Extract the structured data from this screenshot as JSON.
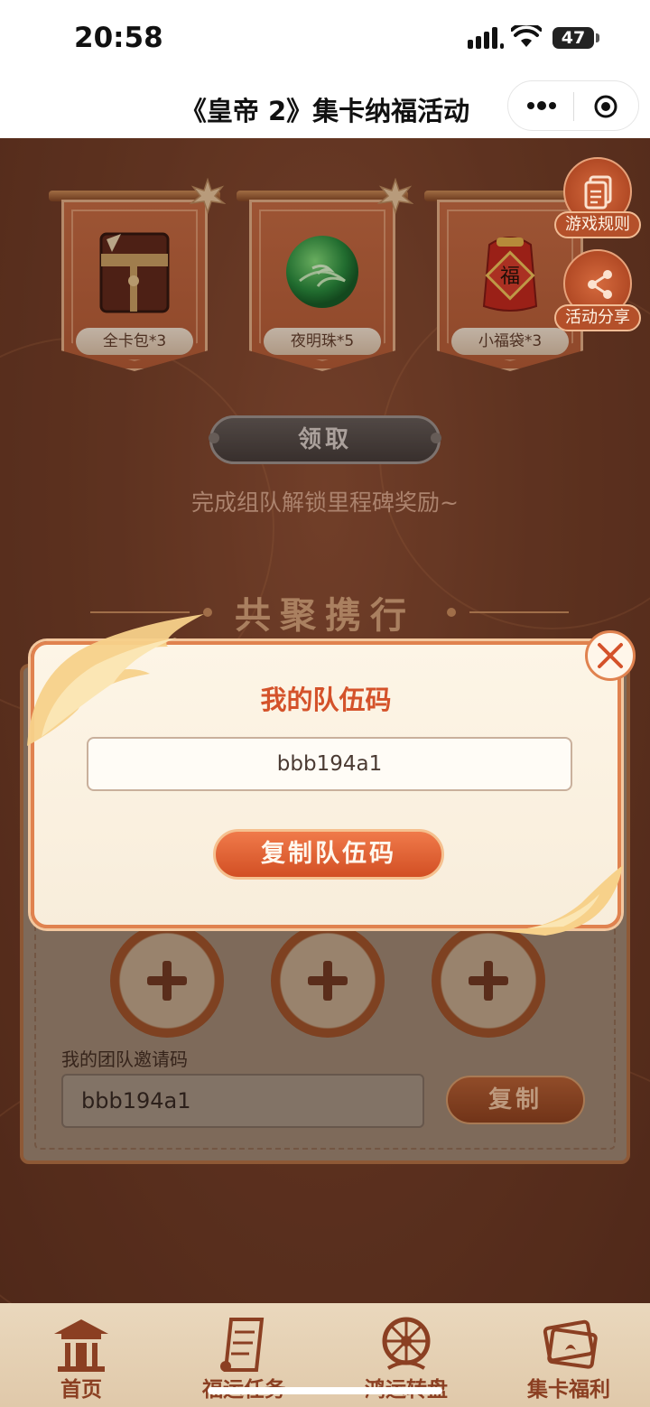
{
  "status_bar": {
    "time": "20:58",
    "battery": "47"
  },
  "nav": {
    "title": "《皇帝 2》集卡纳福活动",
    "more_icon": "more-dots-icon",
    "close_icon": "target-circle-icon"
  },
  "rewards": [
    {
      "label": "全卡包*3",
      "icon": "card-pack-icon"
    },
    {
      "label": "夜明珠*5",
      "icon": "pearl-icon"
    },
    {
      "label": "小福袋*3",
      "icon": "lucky-bag-icon"
    }
  ],
  "claim_button": "领取",
  "hint": "完成组队解锁里程碑奖励~",
  "section_title": "共聚携行",
  "side_buttons": [
    {
      "label": "游戏规则",
      "icon": "rules-document-icon"
    },
    {
      "label": "活动分享",
      "icon": "share-icon"
    }
  ],
  "team": {
    "invite_label": "我的团队邀请码",
    "invite_code": "bbb194a1",
    "copy_label": "复制"
  },
  "modal": {
    "title": "我的队伍码",
    "code": "bbb194a1",
    "copy_button": "复制队伍码"
  },
  "tabs": [
    {
      "label": "首页",
      "icon": "pagoda-icon"
    },
    {
      "label": "福运任务",
      "icon": "scroll-icon"
    },
    {
      "label": "鸿运转盘",
      "icon": "wheel-icon"
    },
    {
      "label": "集卡福利",
      "icon": "cards-icon"
    }
  ],
  "colors": {
    "accent": "#d4522a",
    "background": "#6e3a25",
    "tabbar": "#e6d2b5"
  }
}
